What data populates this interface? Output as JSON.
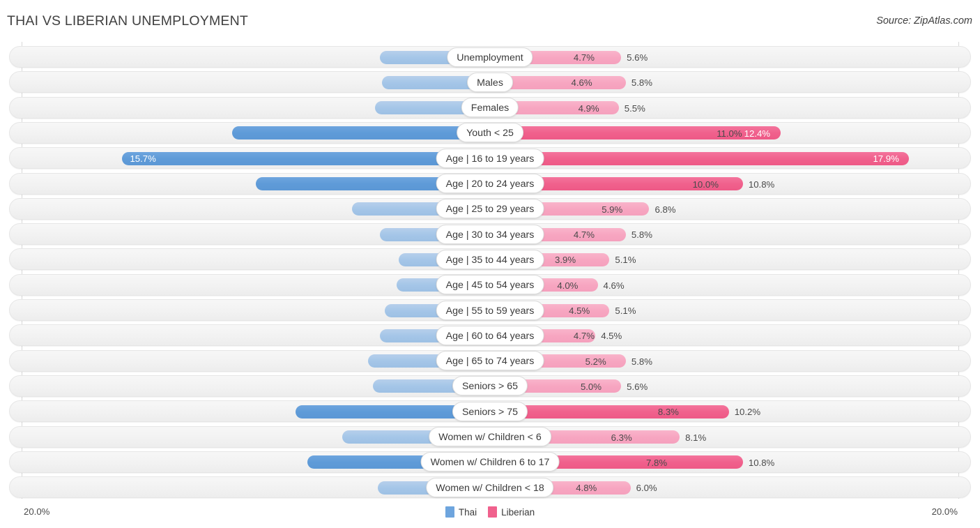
{
  "header": {
    "title": "THAI VS LIBERIAN UNEMPLOYMENT",
    "source": "Source: ZipAtlas.com"
  },
  "axis": {
    "left_label": "20.0%",
    "right_label": "20.0%",
    "max": 20.0
  },
  "legend": {
    "items": [
      {
        "label": "Thai",
        "color": "#6ea5de"
      },
      {
        "label": "Liberian",
        "color": "#f0618d"
      }
    ]
  },
  "colors": {
    "thai_light": "#a5c6e8",
    "thai_dark": "#5f9bd8",
    "liberian_light": "#f7a6c1",
    "liberian_dark": "#f0618d",
    "track": "#f2f2f2",
    "text": "#4a4a4a"
  },
  "chart_data": {
    "type": "bar",
    "title": "THAI VS LIBERIAN UNEMPLOYMENT",
    "subtitle": "",
    "xlabel": "",
    "ylabel": "",
    "orientation": "horizontal-diverging",
    "xlim": [
      20.0,
      20.0
    ],
    "grid": false,
    "legend_position": "bottom-center",
    "categories": [
      "Unemployment",
      "Males",
      "Females",
      "Youth < 25",
      "Age | 16 to 19 years",
      "Age | 20 to 24 years",
      "Age | 25 to 29 years",
      "Age | 30 to 34 years",
      "Age | 35 to 44 years",
      "Age | 45 to 54 years",
      "Age | 55 to 59 years",
      "Age | 60 to 64 years",
      "Age | 65 to 74 years",
      "Seniors > 65",
      "Seniors > 75",
      "Women w/ Children < 6",
      "Women w/ Children 6 to 17",
      "Women w/ Children < 18"
    ],
    "series": [
      {
        "name": "Thai",
        "color": "#a5c6e8",
        "values": [
          4.7,
          4.6,
          4.9,
          11.0,
          15.7,
          10.0,
          5.9,
          4.7,
          3.9,
          4.0,
          4.5,
          4.7,
          5.2,
          5.0,
          8.3,
          6.3,
          7.8,
          4.8
        ]
      },
      {
        "name": "Liberian",
        "color": "#f7a6c1",
        "values": [
          5.6,
          5.8,
          5.5,
          12.4,
          17.9,
          10.8,
          6.8,
          5.8,
          5.1,
          4.6,
          5.1,
          4.5,
          5.8,
          5.6,
          10.2,
          8.1,
          10.8,
          6.0
        ]
      }
    ]
  },
  "rows": [
    {
      "label": "Unemployment",
      "left": "4.7%",
      "right": "5.6%",
      "lv": 4.7,
      "rv": 5.6,
      "lstyle": "lite",
      "rstyle": "lite",
      "lin": false,
      "rin": false
    },
    {
      "label": "Males",
      "left": "4.6%",
      "right": "5.8%",
      "lv": 4.6,
      "rv": 5.8,
      "lstyle": "lite",
      "rstyle": "lite",
      "lin": false,
      "rin": false
    },
    {
      "label": "Females",
      "left": "4.9%",
      "right": "5.5%",
      "lv": 4.9,
      "rv": 5.5,
      "lstyle": "lite",
      "rstyle": "lite",
      "lin": false,
      "rin": false
    },
    {
      "label": "Youth < 25",
      "left": "11.0%",
      "right": "12.4%",
      "lv": 11.0,
      "rv": 12.4,
      "lstyle": "dark",
      "rstyle": "dark",
      "lin": false,
      "rin": true
    },
    {
      "label": "Age | 16 to 19 years",
      "left": "15.7%",
      "right": "17.9%",
      "lv": 15.7,
      "rv": 17.9,
      "lstyle": "dark",
      "rstyle": "dark",
      "lin": true,
      "rin": true
    },
    {
      "label": "Age | 20 to 24 years",
      "left": "10.0%",
      "right": "10.8%",
      "lv": 10.0,
      "rv": 10.8,
      "lstyle": "dark",
      "rstyle": "dark",
      "lin": false,
      "rin": false
    },
    {
      "label": "Age | 25 to 29 years",
      "left": "5.9%",
      "right": "6.8%",
      "lv": 5.9,
      "rv": 6.8,
      "lstyle": "lite",
      "rstyle": "lite",
      "lin": false,
      "rin": false
    },
    {
      "label": "Age | 30 to 34 years",
      "left": "4.7%",
      "right": "5.8%",
      "lv": 4.7,
      "rv": 5.8,
      "lstyle": "lite",
      "rstyle": "lite",
      "lin": false,
      "rin": false
    },
    {
      "label": "Age | 35 to 44 years",
      "left": "3.9%",
      "right": "5.1%",
      "lv": 3.9,
      "rv": 5.1,
      "lstyle": "lite",
      "rstyle": "lite",
      "lin": false,
      "rin": false
    },
    {
      "label": "Age | 45 to 54 years",
      "left": "4.0%",
      "right": "4.6%",
      "lv": 4.0,
      "rv": 4.6,
      "lstyle": "lite",
      "rstyle": "lite",
      "lin": false,
      "rin": false
    },
    {
      "label": "Age | 55 to 59 years",
      "left": "4.5%",
      "right": "5.1%",
      "lv": 4.5,
      "rv": 5.1,
      "lstyle": "lite",
      "rstyle": "lite",
      "lin": false,
      "rin": false
    },
    {
      "label": "Age | 60 to 64 years",
      "left": "4.7%",
      "right": "4.5%",
      "lv": 4.7,
      "rv": 4.5,
      "lstyle": "lite",
      "rstyle": "lite",
      "lin": false,
      "rin": false
    },
    {
      "label": "Age | 65 to 74 years",
      "left": "5.2%",
      "right": "5.8%",
      "lv": 5.2,
      "rv": 5.8,
      "lstyle": "lite",
      "rstyle": "lite",
      "lin": false,
      "rin": false
    },
    {
      "label": "Seniors > 65",
      "left": "5.0%",
      "right": "5.6%",
      "lv": 5.0,
      "rv": 5.6,
      "lstyle": "lite",
      "rstyle": "lite",
      "lin": false,
      "rin": false
    },
    {
      "label": "Seniors > 75",
      "left": "8.3%",
      "right": "10.2%",
      "lv": 8.3,
      "rv": 10.2,
      "lstyle": "dark",
      "rstyle": "dark",
      "lin": false,
      "rin": false
    },
    {
      "label": "Women w/ Children < 6",
      "left": "6.3%",
      "right": "8.1%",
      "lv": 6.3,
      "rv": 8.1,
      "lstyle": "lite",
      "rstyle": "lite",
      "lin": false,
      "rin": false
    },
    {
      "label": "Women w/ Children 6 to 17",
      "left": "7.8%",
      "right": "10.8%",
      "lv": 7.8,
      "rv": 10.8,
      "lstyle": "dark",
      "rstyle": "dark",
      "lin": false,
      "rin": false
    },
    {
      "label": "Women w/ Children < 18",
      "left": "4.8%",
      "right": "6.0%",
      "lv": 4.8,
      "rv": 6.0,
      "lstyle": "lite",
      "rstyle": "lite",
      "lin": false,
      "rin": false
    }
  ]
}
